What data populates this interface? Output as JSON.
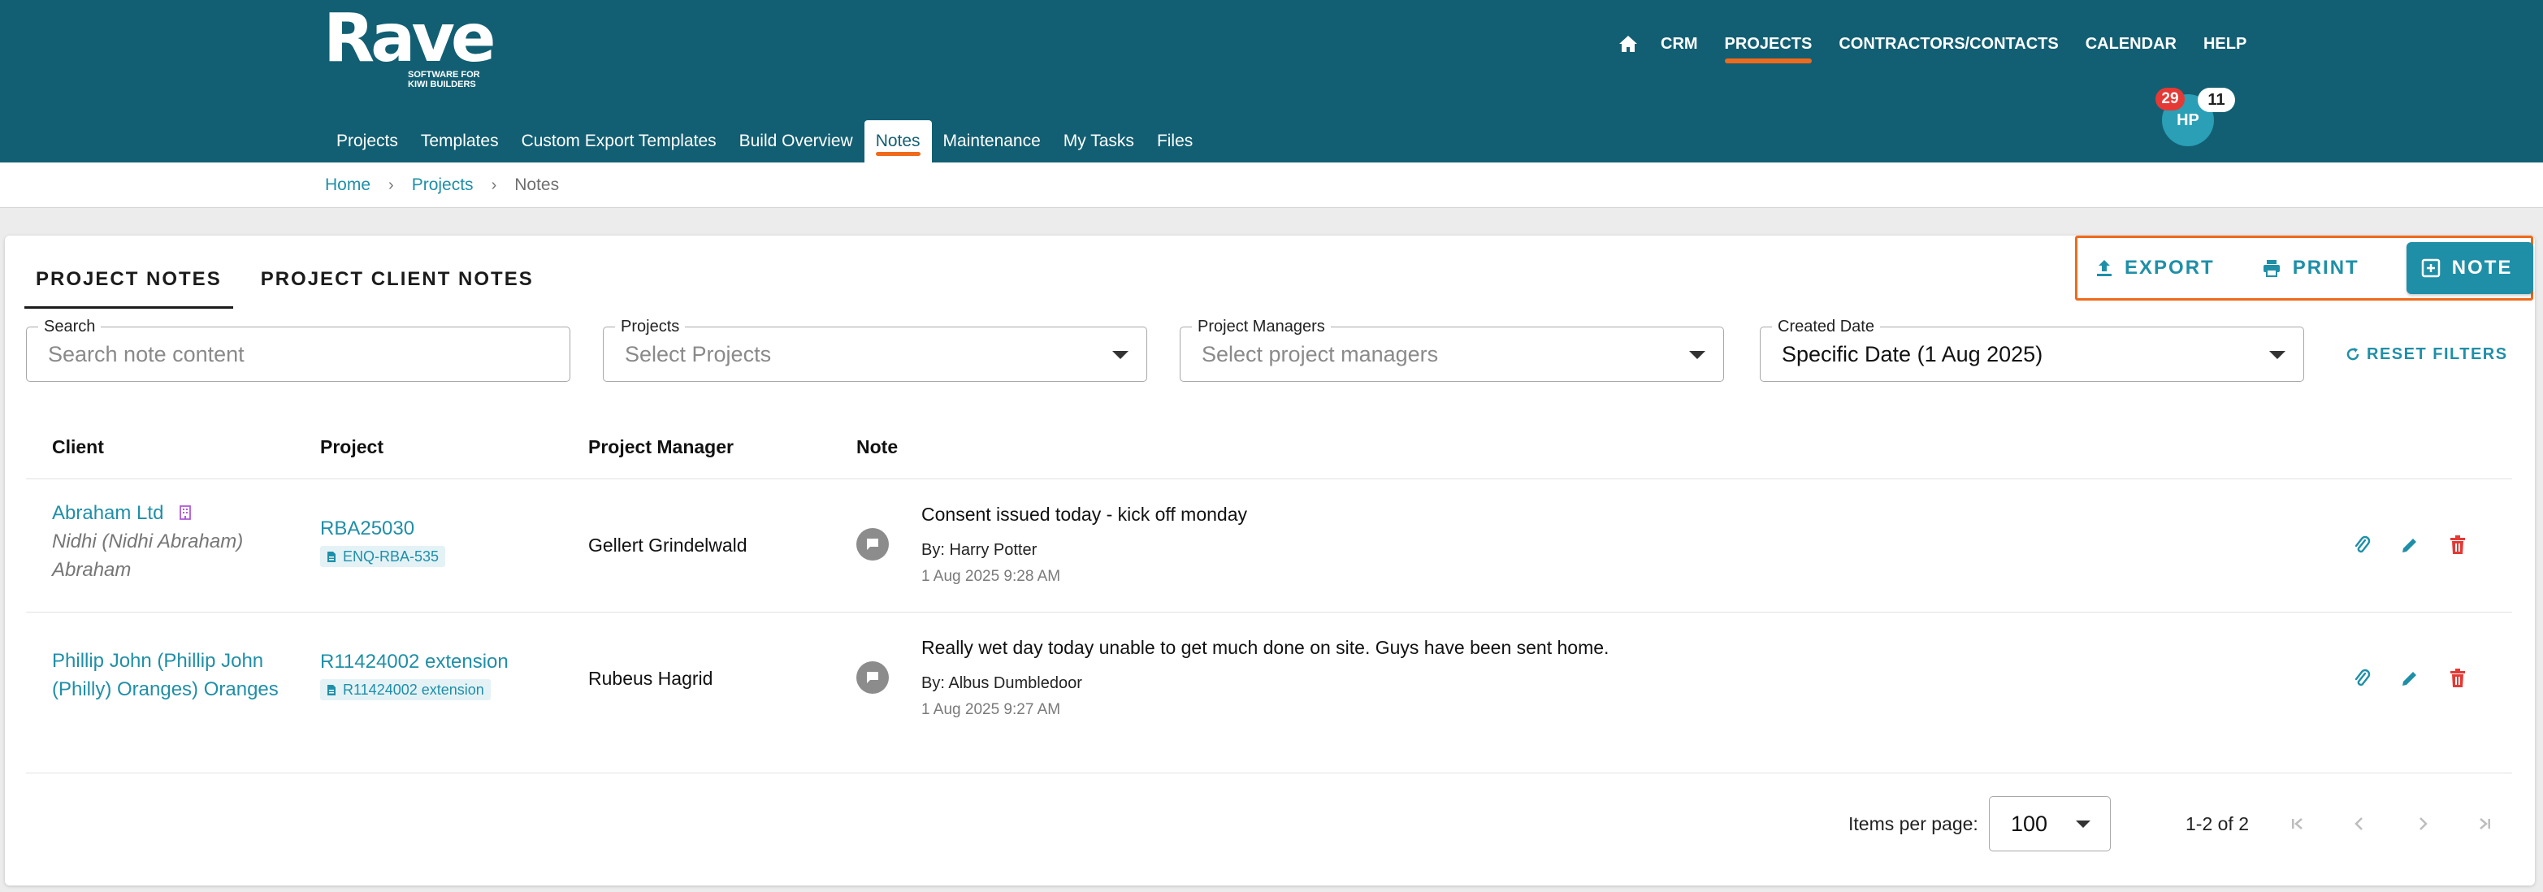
{
  "app": {
    "logo_text": "Rave",
    "logo_tagline": "SOFTWARE FOR KIWI BUILDERS"
  },
  "main_nav": {
    "home_icon": "home-icon",
    "items": [
      "CRM",
      "PROJECTS",
      "CONTRACTORS/CONTACTS",
      "CALENDAR",
      "HELP"
    ],
    "active": "PROJECTS"
  },
  "user": {
    "initials": "HP",
    "badge_red": "29",
    "badge_white": "11",
    "accent_red": "#e53935"
  },
  "sub_nav": {
    "items": [
      "Projects",
      "Templates",
      "Custom Export Templates",
      "Build Overview",
      "Notes",
      "Maintenance",
      "My Tasks",
      "Files"
    ],
    "active": "Notes"
  },
  "breadcrumb": [
    "Home",
    "Projects",
    "Notes"
  ],
  "tabs": [
    "PROJECT NOTES",
    "PROJECT CLIENT NOTES"
  ],
  "actions": {
    "export": "EXPORT",
    "print": "PRINT",
    "note": "NOTE"
  },
  "filters": {
    "search": {
      "label": "Search",
      "placeholder": "Search note content"
    },
    "projects": {
      "label": "Projects",
      "placeholder": "Select Projects"
    },
    "project_managers": {
      "label": "Project Managers",
      "placeholder": "Select project managers"
    },
    "created_date": {
      "label": "Created Date",
      "value": "Specific Date (1 Aug 2025)"
    },
    "reset": "RESET FILTERS"
  },
  "table": {
    "columns": [
      "Client",
      "Project",
      "Project Manager",
      "Note"
    ],
    "rows": [
      {
        "client": "Abraham Ltd",
        "client_icon": "building-icon",
        "client_sub_1": "Nidhi (Nidhi Abraham)",
        "client_sub_2": "Abraham",
        "project": "RBA25030",
        "project_tag": "ENQ-RBA-535",
        "project_manager": "Gellert Grindelwald",
        "note": "Consent issued today - kick off monday",
        "by": "By: Harry Potter",
        "date": "1 Aug 2025 9:28 AM"
      },
      {
        "client_line_1": "Phillip John (Phillip John",
        "client_line_2": "(Philly) Oranges) Oranges",
        "project": "R11424002 extension",
        "project_tag": "R11424002 extension",
        "project_manager": "Rubeus Hagrid",
        "note": "Really wet day today unable to get much done on site. Guys have been sent home.",
        "by": "By: Albus Dumbledoor",
        "date": "1 Aug 2025 9:27 AM"
      }
    ]
  },
  "pagination": {
    "items_per_page_label": "Items per page:",
    "items_per_page": "100",
    "range": "1-2 of 2"
  },
  "colors": {
    "header_bg": "#125f73",
    "accent_teal": "#1f8fa8",
    "accent_orange": "#f06a1c",
    "delete_red": "#e53935"
  }
}
